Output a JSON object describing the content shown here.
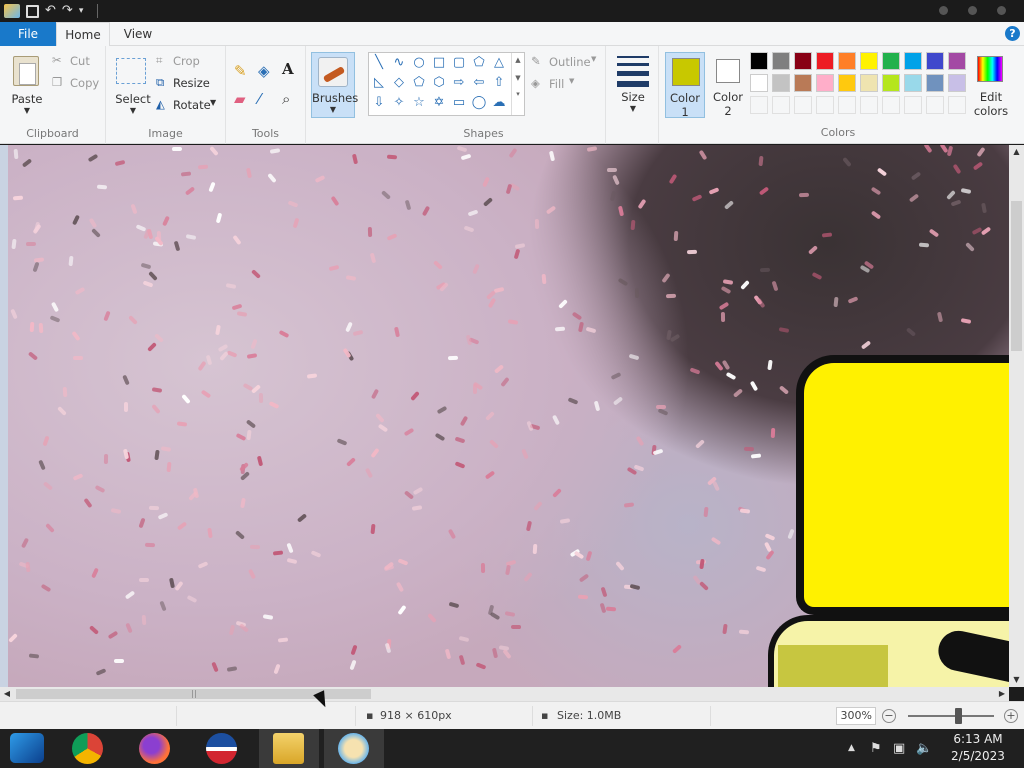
{
  "titlebar": {},
  "tabs": {
    "file": "File",
    "home": "Home",
    "view": "View",
    "help": "?"
  },
  "ribbon": {
    "clipboard": {
      "paste": "Paste",
      "cut": "Cut",
      "copy": "Copy",
      "group": "Clipboard"
    },
    "image": {
      "select": "Select",
      "crop": "Crop",
      "resize": "Resize",
      "rotate": "Rotate",
      "group": "Image"
    },
    "tools": {
      "group": "Tools",
      "text_glyph": "A"
    },
    "brushes": {
      "label": "Brushes"
    },
    "shapes": {
      "outline": "Outline",
      "fill": "Fill",
      "group": "Shapes"
    },
    "size": {
      "label": "Size"
    },
    "colors": {
      "color1_label": "Color",
      "color1_num": "1",
      "color2_label": "Color",
      "color2_num": "2",
      "edit_label": "Edit",
      "edit_label2": "colors",
      "group": "Colors",
      "color1_value": "#c8c800",
      "color2_value": "#ffffff",
      "palette_row1": [
        "#000000",
        "#7f7f7f",
        "#880015",
        "#ed1c24",
        "#ff7f27",
        "#fff200",
        "#22b14c",
        "#00a2e8",
        "#3f48cc",
        "#a349a4"
      ],
      "palette_row2": [
        "#ffffff",
        "#c3c3c3",
        "#b97a57",
        "#ffaec9",
        "#ffc90e",
        "#efe4b0",
        "#b5e61d",
        "#99d9ea",
        "#7092be",
        "#c8bfe7"
      ]
    }
  },
  "status": {
    "dimensions": "918 × 610px",
    "size": "Size: 1.0MB",
    "zoom": "300%"
  },
  "taskbar": {
    "apps": [
      "windows-media-icon",
      "chrome-icon",
      "firefox-icon",
      "obama-logo-icon",
      "file-explorer-icon",
      "paint-icon"
    ],
    "time": "6:13 AM",
    "date": "2/5/2023"
  }
}
